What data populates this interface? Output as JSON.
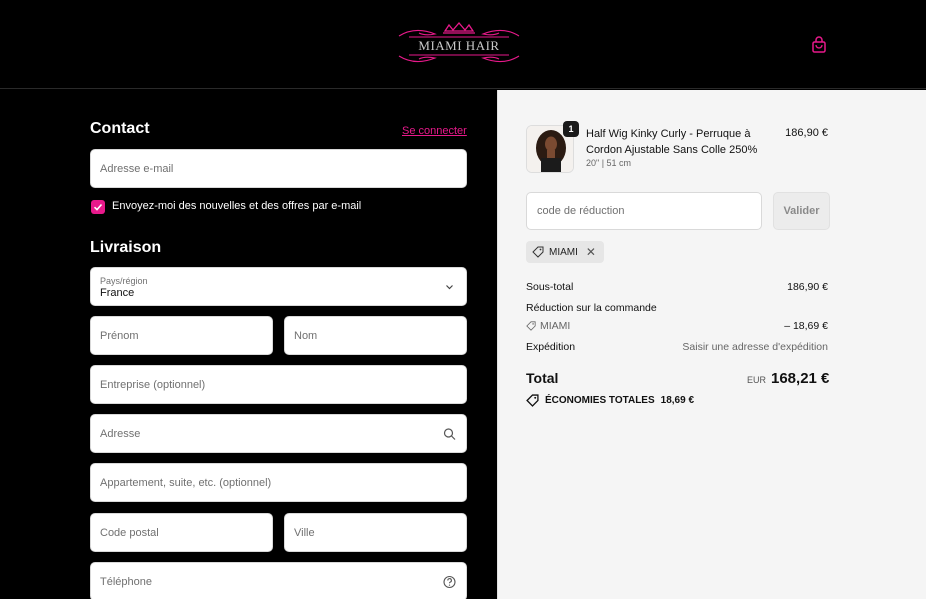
{
  "header": {
    "logo_text": "MIAMI HAIR",
    "logo_icon": "crown-logo",
    "cart_icon": "shopping-bag-icon",
    "accent_color": "#e8198b"
  },
  "contact": {
    "title": "Contact",
    "login_link": "Se connecter",
    "email_placeholder": "Adresse e-mail",
    "newsletter_label": "Envoyez-moi des nouvelles et des offres par e-mail",
    "newsletter_checked": true
  },
  "delivery": {
    "title": "Livraison",
    "country_label": "Pays/région",
    "country_value": "France",
    "first_name_placeholder": "Prénom",
    "last_name_placeholder": "Nom",
    "company_placeholder": "Entreprise (optionnel)",
    "address_placeholder": "Adresse",
    "apartment_placeholder": "Appartement, suite, etc. (optionnel)",
    "postal_code_placeholder": "Code postal",
    "city_placeholder": "Ville",
    "phone_placeholder": "Téléphone"
  },
  "order": {
    "product": {
      "title": "Half Wig Kinky Curly - Perruque à Cordon Ajustable Sans Colle 250%",
      "variant": "20\" | 51 cm",
      "quantity": "1",
      "price": "186,90 €"
    },
    "discount_placeholder": "code de réduction",
    "apply_label": "Valider",
    "applied_code": "MIAMI",
    "subtotal_label": "Sous-total",
    "subtotal_value": "186,90 €",
    "order_discount_label": "Réduction sur la commande",
    "discount_code_label": "MIAMI",
    "discount_value": "– 18,69 €",
    "shipping_label": "Expédition",
    "shipping_value": "Saisir une adresse d'expédition",
    "total_label": "Total",
    "currency": "EUR",
    "total_value": "168,21 €",
    "savings_label": "ÉCONOMIES TOTALES",
    "savings_value": "18,69 €"
  }
}
